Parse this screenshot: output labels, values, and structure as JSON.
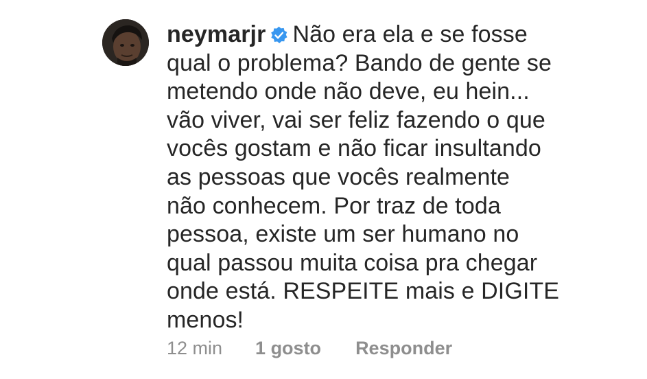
{
  "comment": {
    "username": "neymarjr",
    "verified_icon": "verified-badge-icon",
    "text_lines": [
      "Não era ela e se fosse",
      "qual o problema? Bando de gente se",
      "metendo onde não deve, eu hein...",
      "vão viver, vai ser feliz fazendo o que",
      "vocês gostam e não ficar insultando",
      "as pessoas que vocês realmente",
      "não conhecem. Por traz de toda",
      "pessoa, existe um ser humano no",
      "qual passou muita coisa pra chegar",
      "onde está. RESPEITE mais e DIGITE",
      "menos!"
    ],
    "time": "12 min",
    "likes": "1 gosto",
    "reply_label": "Responder"
  },
  "colors": {
    "text": "#262626",
    "secondary": "#8e8e8e",
    "verified": "#3897f0"
  }
}
